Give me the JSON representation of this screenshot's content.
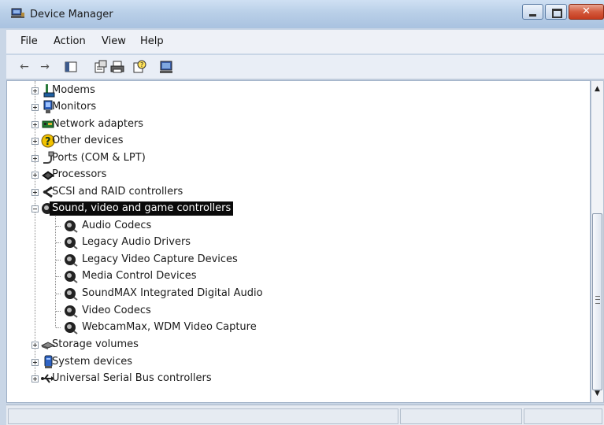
{
  "window": {
    "title": "Device Manager"
  },
  "menu": {
    "file": "File",
    "action": "Action",
    "view": "View",
    "help": "Help"
  },
  "toolbar": {
    "buttons": [
      "back-icon",
      "forward-icon",
      "console-tree-icon",
      "properties-icon",
      "print-icon",
      "help-icon",
      "scan-hardware-icon"
    ]
  },
  "tree": {
    "items": [
      {
        "label": "Modems",
        "icon": "modem-icon"
      },
      {
        "label": "Monitors",
        "icon": "monitor-icon"
      },
      {
        "label": "Network adapters",
        "icon": "network-adapter-icon"
      },
      {
        "label": "Other devices",
        "icon": "unknown-device-icon"
      },
      {
        "label": "Ports (COM & LPT)",
        "icon": "port-icon"
      },
      {
        "label": "Processors",
        "icon": "processor-icon"
      },
      {
        "label": "SCSI and RAID controllers",
        "icon": "scsi-icon"
      },
      {
        "label": "Sound, video and game controllers",
        "icon": "speaker-icon",
        "expanded": true,
        "selected": true
      },
      {
        "label": "Storage volumes",
        "icon": "storage-volume-icon"
      },
      {
        "label": "System devices",
        "icon": "system-device-icon"
      },
      {
        "label": "Universal Serial Bus controllers",
        "icon": "usb-icon"
      }
    ],
    "sound_children": [
      "Audio Codecs",
      "Legacy Audio Drivers",
      "Legacy Video Capture Devices",
      "Media Control Devices",
      "SoundMAX Integrated Digital Audio",
      "Video Codecs",
      "WebcamMax, WDM Video Capture"
    ]
  },
  "status": {
    "text": ""
  }
}
